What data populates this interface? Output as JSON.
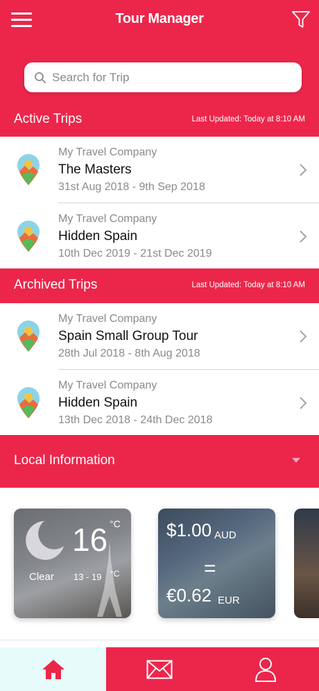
{
  "header": {
    "title": "Tour Manager"
  },
  "search": {
    "placeholder": "Search for Trip"
  },
  "active_trips": {
    "title": "Active Trips",
    "last_updated": "Last Updated: Today at 8:10 AM",
    "items": [
      {
        "company": "My Travel Company",
        "name": "The Masters",
        "dates": "31st Aug 2018 - 9th Sep 2018"
      },
      {
        "company": "My Travel Company",
        "name": "Hidden Spain",
        "dates": "10th Dec 2019 - 21st Dec 2019"
      }
    ]
  },
  "archived_trips": {
    "title": "Archived Trips",
    "last_updated": "Last Updated: Today at 8:10 AM",
    "items": [
      {
        "company": "My Travel Company",
        "name": "Spain Small Group Tour",
        "dates": "28th Jul 2018 - 8th Aug 2018"
      },
      {
        "company": "My Travel Company",
        "name": "Hidden Spain",
        "dates": "13th Dec 2018 - 24th Dec 2018"
      }
    ]
  },
  "local_info": {
    "title": "Local Information",
    "weather": {
      "temp": "16",
      "temp_unit": "°C",
      "condition": "Clear",
      "range": "13 - 19",
      "range_unit": "°C",
      "icon": "moon-icon"
    },
    "currency": {
      "from_amount": "$1.00",
      "from_code": "AUD",
      "equals": "=",
      "to_amount": "€0.62",
      "to_code": "EUR"
    }
  },
  "tabs": [
    {
      "icon": "home-icon",
      "active": true
    },
    {
      "icon": "mail-icon",
      "active": false
    },
    {
      "icon": "profile-icon",
      "active": false
    }
  ],
  "colors": {
    "accent": "#ec264b",
    "active_tab_bg": "#e6fbfa",
    "text_primary": "#111111",
    "text_secondary": "#8a8a8a"
  }
}
